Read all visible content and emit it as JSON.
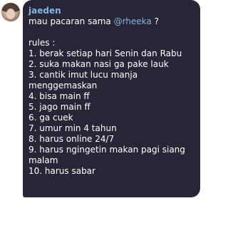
{
  "message": {
    "author": "jaeden",
    "first_line_prefix": "mau pacaran sama ",
    "mention": "@rheeka",
    "first_line_suffix": " ?",
    "rules_title": "rules :",
    "rules": [
      "1. berak setiap hari Senin dan Rabu",
      "2. suka makan nasi ga pake lauk",
      "3. cantik imut lucu manja",
      "menggemaskan",
      "4. bisa main ff",
      "5. jago main ff",
      "6. ga cuek",
      "7. umur min 4 tahun",
      "8. harus online 24/7",
      "9. harus ngingetin makan pagi siang",
      "malam",
      "10. harus sabar"
    ]
  },
  "colors": {
    "bubble": "#282536",
    "author": "#7fb7ea",
    "mention": "#7fb7ea",
    "text": "#ffffff"
  },
  "icons": {
    "avatar": "profile-photo"
  }
}
